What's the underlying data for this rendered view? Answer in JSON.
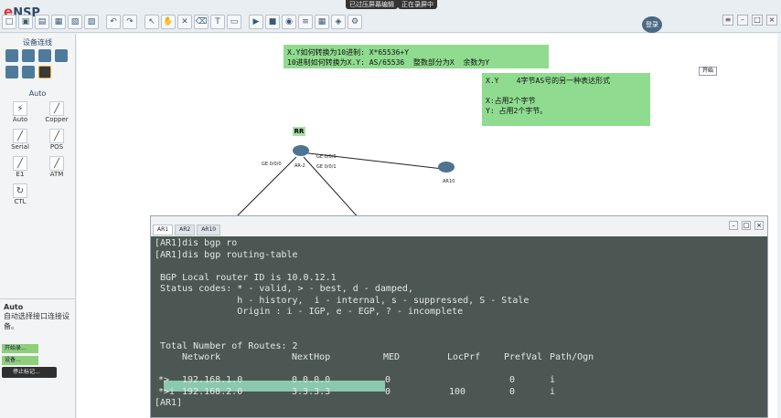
{
  "app": {
    "title": "eNSP",
    "logo_prefix": "e",
    "logo_main": "NSP"
  },
  "top_notices": [
    "已过压屏幕编辑",
    "正在录屏中"
  ],
  "user_badge": "登录",
  "left_panel": {
    "title": "设备连线",
    "section_label": "Auto",
    "cables": [
      "Auto",
      "Copper",
      "Serial",
      "POS",
      "E1",
      "ATM",
      "CTL"
    ],
    "auto_title": "Auto",
    "auto_desc": "自动选择接口连接设备。",
    "green_btn_1": "开始录...",
    "green_btn_2": "设备...",
    "dark_btn": "停止标记..."
  },
  "canvas": {
    "note1": "X.Y如何转换为10进制: X*65536+Y\n10进制如何转换为X.Y: AS/65536  整数部分为X  余数为Y",
    "note2": "X.Y    4字节AS号的另一种表达形式\n\nX:占用2个字节\nY: 占用2个字节。",
    "rr_label": "RR",
    "ar2_label": "AR-2",
    "ar10_label": "AR10",
    "ge000": "GE 0/0/0",
    "ge001": "GE 0/0/1",
    "ge000b": "GE 0/0/0",
    "start_btn": "开始"
  },
  "cli": {
    "tabs": [
      "AR1",
      "AR2",
      "AR10"
    ],
    "lines": [
      "[AR1]dis bgp ro",
      "[AR1]dis bgp routing-table",
      "",
      " BGP Local router ID is 10.0.12.1",
      " Status codes: * - valid, > - best, d - damped,",
      "               h - history,  i - internal, s - suppressed, S - Stale",
      "               Origin : i - IGP, e - EGP, ? - incomplete",
      "",
      "",
      " Total Number of Routes: 2"
    ],
    "header": [
      "Network",
      "NextHop",
      "MED",
      "LocPrf",
      "PrefVal",
      "Path/Ogn"
    ],
    "rows": [
      [
        "*>",
        "192.168.1.0",
        "0.0.0.0",
        "0",
        "",
        "0",
        "i"
      ],
      [
        "*>i",
        "192.168.2.0",
        "3.3.3.3",
        "0",
        "100",
        "0",
        "i"
      ]
    ],
    "prompt": "[AR1]"
  }
}
